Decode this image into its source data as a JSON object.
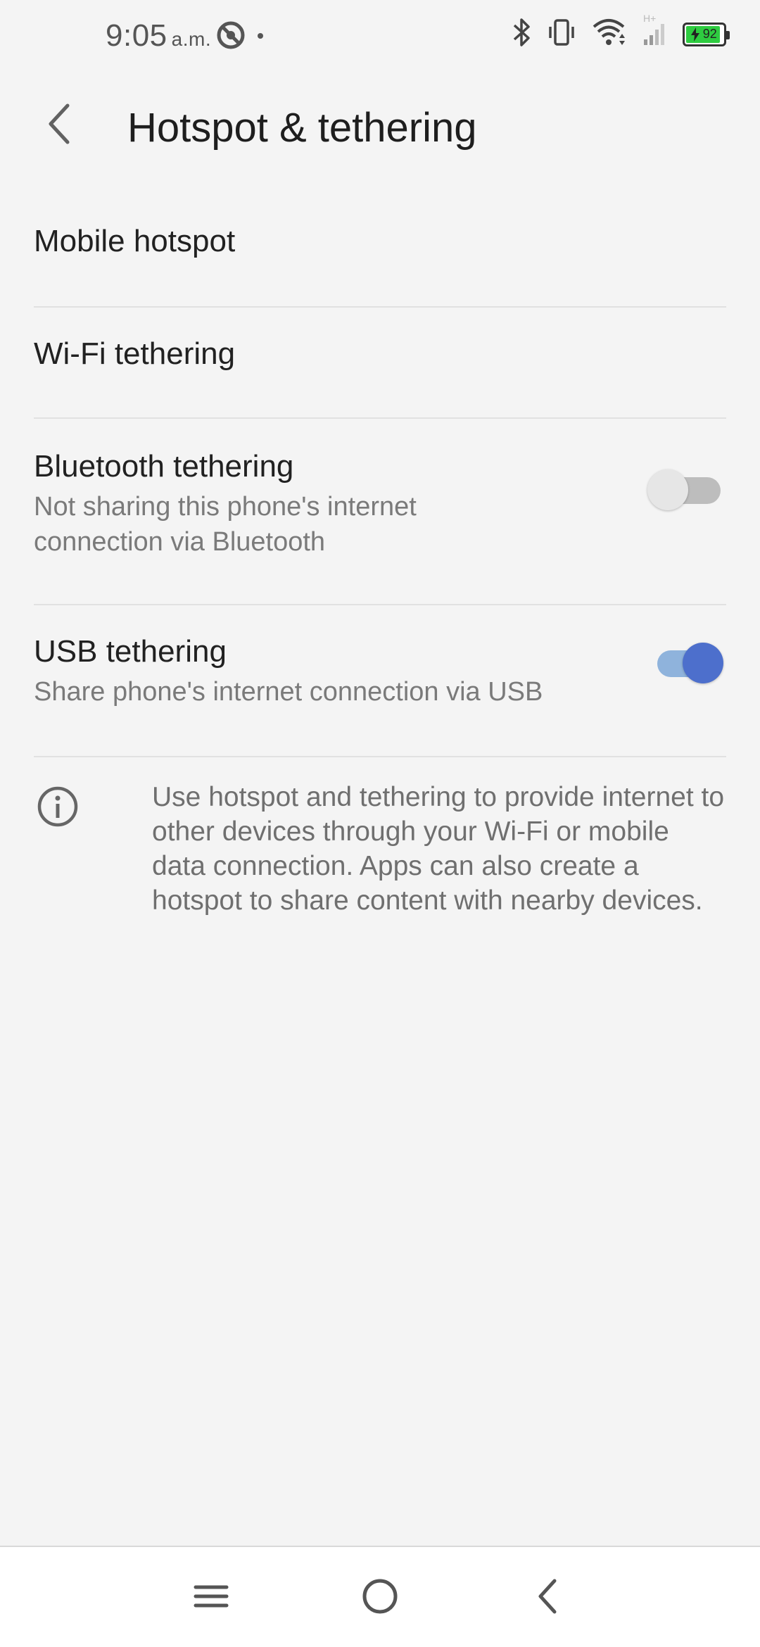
{
  "status_bar": {
    "time": "9:05",
    "ampm": "a.m.",
    "network_type": "H+",
    "battery_level": "92",
    "battery_percent": 92,
    "battery_color": "#2ecc40",
    "icons": [
      "do-not-disturb-icon",
      "notification-dot-icon",
      "bluetooth-icon",
      "vibrate-icon",
      "wifi-icon",
      "cell-signal-icon",
      "battery-charging-icon"
    ]
  },
  "app_bar": {
    "title": "Hotspot & tethering",
    "back_icon": "back-arrow-icon"
  },
  "settings": {
    "mobile_hotspot": {
      "title": "Mobile hotspot"
    },
    "wifi_tethering": {
      "title": "Wi-Fi tethering"
    },
    "bluetooth_tethering": {
      "title": "Bluetooth tethering",
      "summary": "Not sharing this phone's internet connection via Bluetooth",
      "enabled": false
    },
    "usb_tethering": {
      "title": "USB tethering",
      "summary": "Share phone's internet connection via USB",
      "enabled": true
    }
  },
  "info": {
    "icon": "info-icon",
    "text": "Use hotspot and tethering to provide internet to other devices through your Wi-Fi or mobile data connection. Apps can also create a hotspot to share content with nearby devices."
  },
  "nav_bar": {
    "buttons": [
      "recents-icon",
      "home-icon",
      "back-icon"
    ]
  },
  "colors": {
    "background": "#f4f4f4",
    "accent": "#4d6fcc",
    "accent_track": "#8fb3dc",
    "divider": "#e1e1e1"
  }
}
